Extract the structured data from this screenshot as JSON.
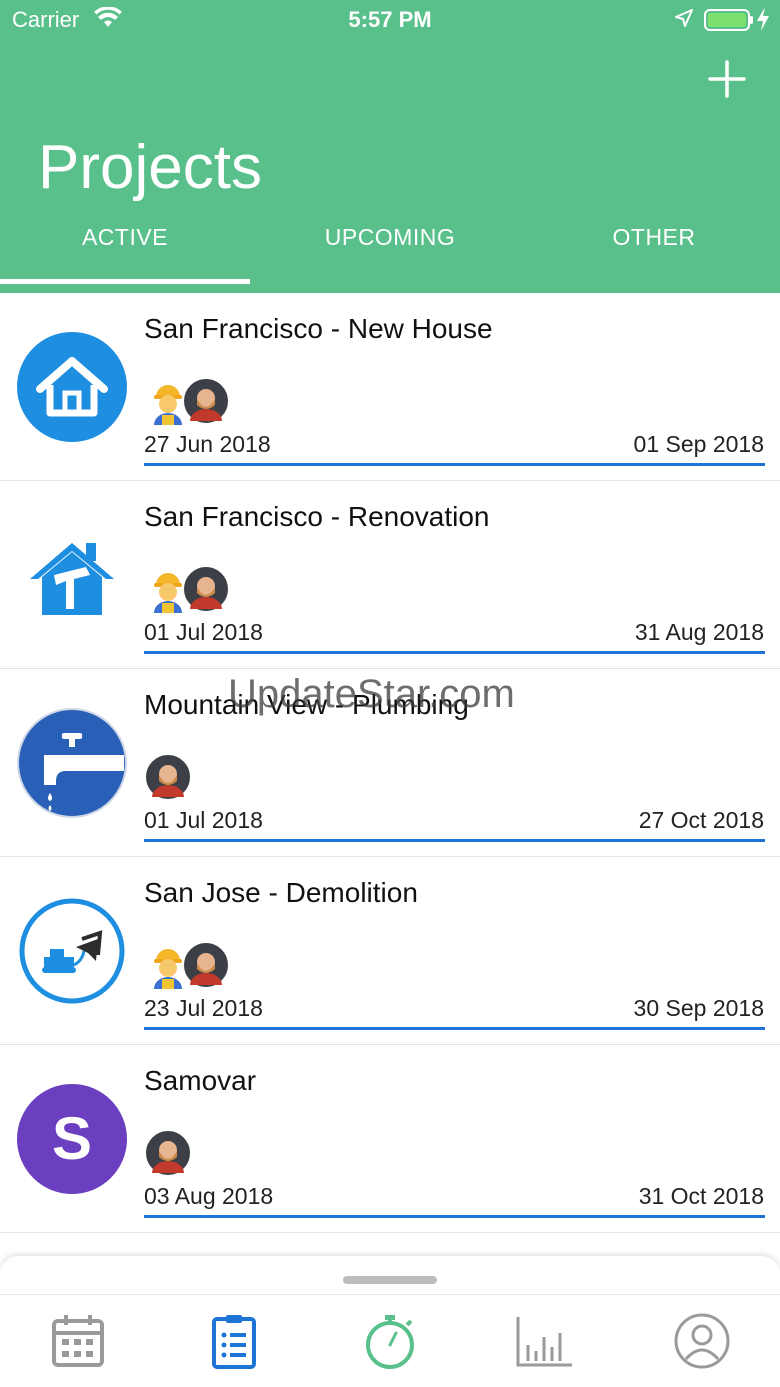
{
  "status_bar": {
    "carrier": "Carrier",
    "time": "5:57 PM"
  },
  "header": {
    "title": "Projects",
    "tabs": [
      {
        "label": "ACTIVE",
        "active": true
      },
      {
        "label": "UPCOMING",
        "active": false
      },
      {
        "label": "OTHER",
        "active": false
      }
    ]
  },
  "projects": [
    {
      "title": "San Francisco - New House",
      "start": "27 Jun 2018",
      "end": "01 Sep 2018",
      "icon": "house-icon",
      "members": [
        "worker-avatar",
        "bearded-man-avatar"
      ]
    },
    {
      "title": "San Francisco - Renovation",
      "start": "01 Jul 2018",
      "end": "31 Aug 2018",
      "icon": "renovation-house-icon",
      "members": [
        "worker-avatar",
        "bearded-man-avatar"
      ]
    },
    {
      "title": "Mountain View - Plumbing",
      "start": "01 Jul 2018",
      "end": "27 Oct 2018",
      "icon": "faucet-icon",
      "members": [
        "bearded-man-avatar"
      ]
    },
    {
      "title": "San Jose - Demolition",
      "start": "23 Jul 2018",
      "end": "30 Sep 2018",
      "icon": "bulldozer-icon",
      "members": [
        "worker-avatar",
        "bearded-man-avatar"
      ]
    },
    {
      "title": "Samovar",
      "start": "03 Aug 2018",
      "end": "31 Oct 2018",
      "icon": "letter-s-avatar",
      "letter": "S",
      "members": [
        "bearded-man-avatar"
      ]
    }
  ],
  "watermark": "UpdateStar.com",
  "tabbar": [
    "calendar-icon",
    "clipboard-list-icon",
    "stopwatch-icon",
    "bar-chart-icon",
    "profile-icon"
  ],
  "colors": {
    "header": "#59c08b",
    "progress": "#1e74d6",
    "active_tab_icon": "#1e74d6",
    "timer_icon": "#59c08b",
    "inactive_icon": "#9a9a9a",
    "samovar_avatar": "#6b3fbf"
  }
}
